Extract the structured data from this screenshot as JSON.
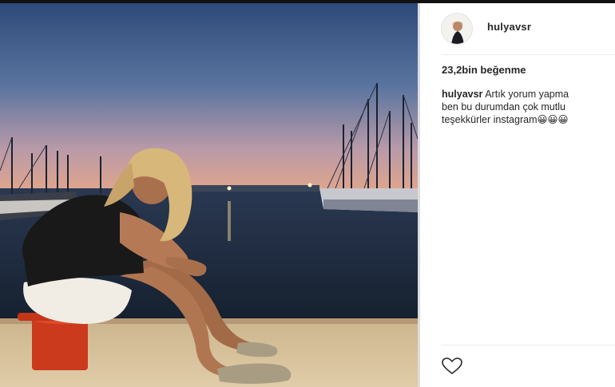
{
  "post": {
    "username": "hulyavsr",
    "likes": "23,2bin beğenme",
    "caption": {
      "username": "hulyavsr",
      "line1": "Artık yorum yapma",
      "line2": "ben bu durumdan çok mutlu",
      "line3": "teşekkürler instagram😀😀😀"
    }
  },
  "icons": {
    "like": "heart-outline-icon",
    "avatar": "profile-avatar"
  },
  "colors": {
    "text": "#262626",
    "divider": "#ececec",
    "sky_top": "#3f5b86",
    "sky_bottom": "#c89a9a",
    "sea": "#1f2c40",
    "pier": "#d8c39b",
    "bollard": "#d23a1f"
  }
}
